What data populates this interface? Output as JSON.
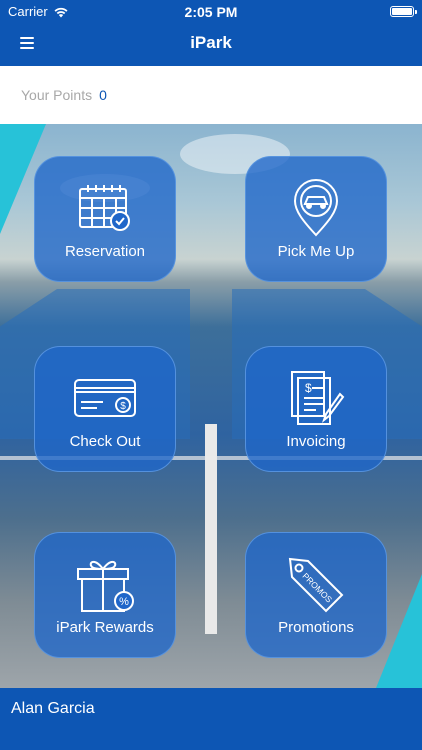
{
  "status_bar": {
    "carrier": "Carrier",
    "time": "2:05 PM"
  },
  "nav": {
    "title": "iPark",
    "menu_icon": "hamburger-menu-icon"
  },
  "points": {
    "label": "Your Points",
    "value": "0"
  },
  "tiles": [
    {
      "label": "Reservation",
      "icon": "calendar-check-icon"
    },
    {
      "label": "Pick Me Up",
      "icon": "car-location-pin-icon"
    },
    {
      "label": "Check Out",
      "icon": "payment-card-icon"
    },
    {
      "label": "Invoicing",
      "icon": "invoice-document-icon"
    },
    {
      "label": "iPark Rewards",
      "icon": "gift-box-icon"
    },
    {
      "label": "Promotions",
      "icon": "promos-tag-icon"
    }
  ],
  "footer": {
    "user_name": "Alan Garcia"
  },
  "colors": {
    "brand_blue": "#0d56b4",
    "tile_blue": "#1f66c9",
    "accent_teal": "#27c2d8"
  }
}
